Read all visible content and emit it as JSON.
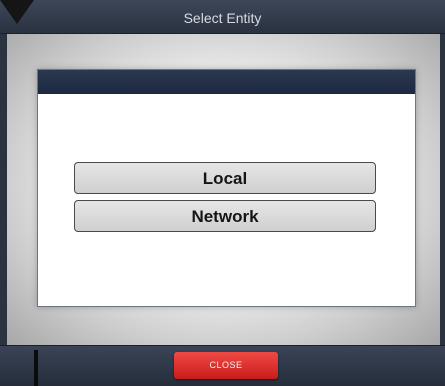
{
  "window": {
    "title": "Select Entity"
  },
  "dialog": {
    "options": [
      {
        "label": "Local"
      },
      {
        "label": "Network"
      }
    ]
  },
  "footer": {
    "close_label": "CLOSE"
  },
  "colors": {
    "header_dark": "#2a3850",
    "close_red": "#e0312e",
    "option_grey": "#dcdcdc"
  },
  "icons": {
    "pointer": "mouse-pointer-icon",
    "text_cursor": "text-cursor-icon"
  }
}
